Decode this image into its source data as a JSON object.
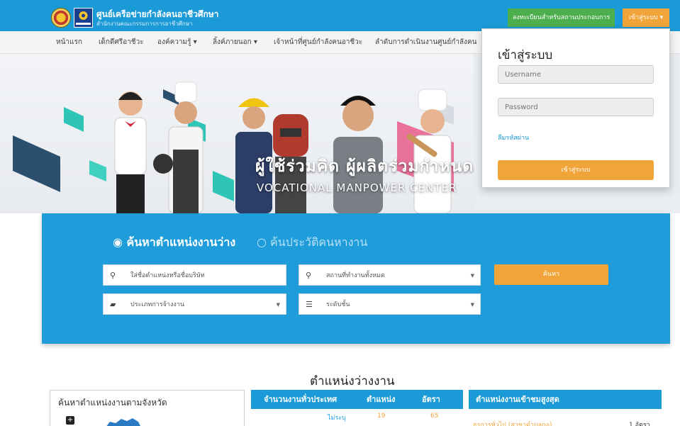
{
  "header": {
    "brand_title": "ศูนย์เครือข่ายกำลังคนอาชีวศึกษา",
    "brand_subtitle": "สำนักงานคณะกรรมการการอาชีวศึกษา",
    "register_button": "ลงทะเบียนสำหรับสถานประกอบการ",
    "login_button": "เข้าสู่ระบบ ▾"
  },
  "nav": {
    "items": [
      {
        "label": "หน้าแรก"
      },
      {
        "label": "เด็กดีศรีอาชีวะ"
      },
      {
        "label": "องค์ความรู้ ▾"
      },
      {
        "label": "ลิ้งค์ภายนอก ▾"
      },
      {
        "label": "เจ้าหน้าที่ศูนย์กำลังคนอาชีวะ"
      },
      {
        "label": "ลำดับการดำเนินงานศูนย์กำลังคน"
      }
    ]
  },
  "hero": {
    "title": "ผู้ใช้ร่วมคิด ผู้ผลิตร่วมกำหนด",
    "subtitle": "VOCATIONAL MANPOWER CENTER"
  },
  "login": {
    "title": "เข้าสู่ระบบ",
    "username_placeholder": "Username",
    "password_placeholder": "Password",
    "forgot": "ลืมรหัสผ่าน",
    "submit": "เข้าสู่ระบบ"
  },
  "search": {
    "tab_active": "◉ ค้นหาตำแหน่งงานว่าง",
    "tab_inactive": "○ ค้นประวัติคนหางาน",
    "keyword_placeholder": "ใส่ชื่อตำแหน่งหรือชื่อบริษัท",
    "location_value": "สถานที่ทำงานทั้งหมด",
    "employment_type_value": "ประเภทการจ้างงาน",
    "level_value": "ระดับชั้น",
    "search_button": "ค้นหา",
    "icons": {
      "keyword": "search-icon",
      "location": "map-pin-icon",
      "employment": "briefcase-icon",
      "level": "list-icon"
    }
  },
  "vacancies": {
    "heading": "ตำแหน่งว่างงาน",
    "province_title": "ค้นหาตำแหน่งงานตามจังหวัด",
    "province_expand": "+",
    "stats": {
      "headers": [
        "จำนวนงานทั่วประเทศ",
        "ตำแหน่ง",
        "อัตรา"
      ],
      "row": {
        "label": "ไม่ระบุ",
        "positions": "19",
        "rate": "65"
      }
    },
    "top": {
      "heading": "ตำแหน่งงานเข้าชมสูงสุด",
      "item_label": "ธุรการทั่วไป (สาขาตำบลกอ)",
      "item_count": "1 อัตรา"
    }
  }
}
